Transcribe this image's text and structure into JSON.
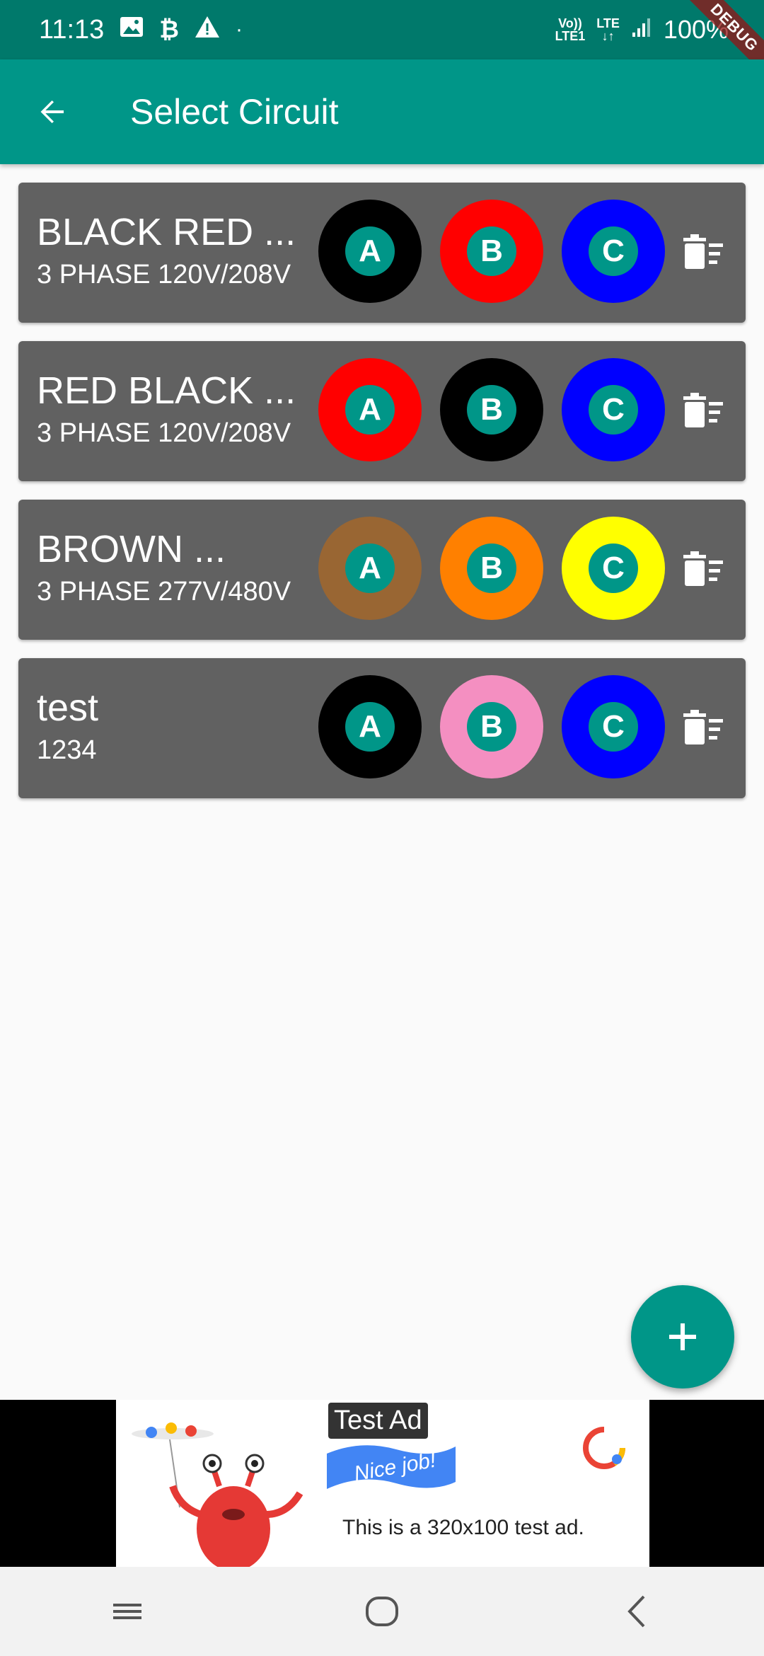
{
  "status_bar": {
    "time": "11:13",
    "left_icons": [
      "image-icon",
      "bitcoin-icon",
      "warning-icon",
      "dot-icon"
    ],
    "network_top": "Vo))",
    "network_bottom": "LTE1",
    "lte_label": "LTE",
    "battery": "100%",
    "debug_banner": "DEBUG"
  },
  "app_bar": {
    "title": "Select Circuit",
    "back_icon": "arrow-back-icon"
  },
  "circuits": [
    {
      "title": "BLACK RED ...",
      "subtitle": "3 PHASE 120V/208V",
      "phases": [
        {
          "label": "A",
          "color": "#000000"
        },
        {
          "label": "B",
          "color": "#ff0000"
        },
        {
          "label": "C",
          "color": "#0000ff"
        }
      ]
    },
    {
      "title": "RED BLACK ...",
      "subtitle": "3 PHASE 120V/208V",
      "phases": [
        {
          "label": "A",
          "color": "#ff0000"
        },
        {
          "label": "B",
          "color": "#000000"
        },
        {
          "label": "C",
          "color": "#0000ff"
        }
      ]
    },
    {
      "title": "BROWN ...",
      "subtitle": "3 PHASE 277V/480V",
      "phases": [
        {
          "label": "A",
          "color": "#996633"
        },
        {
          "label": "B",
          "color": "#ff8000"
        },
        {
          "label": "C",
          "color": "#ffff00"
        }
      ]
    },
    {
      "title": "test",
      "subtitle": "1234",
      "phases": [
        {
          "label": "A",
          "color": "#000000"
        },
        {
          "label": "B",
          "color": "#f48fc1"
        },
        {
          "label": "C",
          "color": "#0000ff"
        }
      ]
    }
  ],
  "fab": {
    "icon": "add-icon"
  },
  "ad": {
    "label": "Test Ad",
    "flag_text": "Nice job!",
    "text": "This is a 320x100 test ad."
  },
  "nav_bar": {
    "icons": [
      "recent-apps-icon",
      "home-icon",
      "back-icon"
    ]
  },
  "colors": {
    "primary": "#009688",
    "primary_dark": "#00796b",
    "card": "#616161",
    "background": "#fafafa"
  }
}
